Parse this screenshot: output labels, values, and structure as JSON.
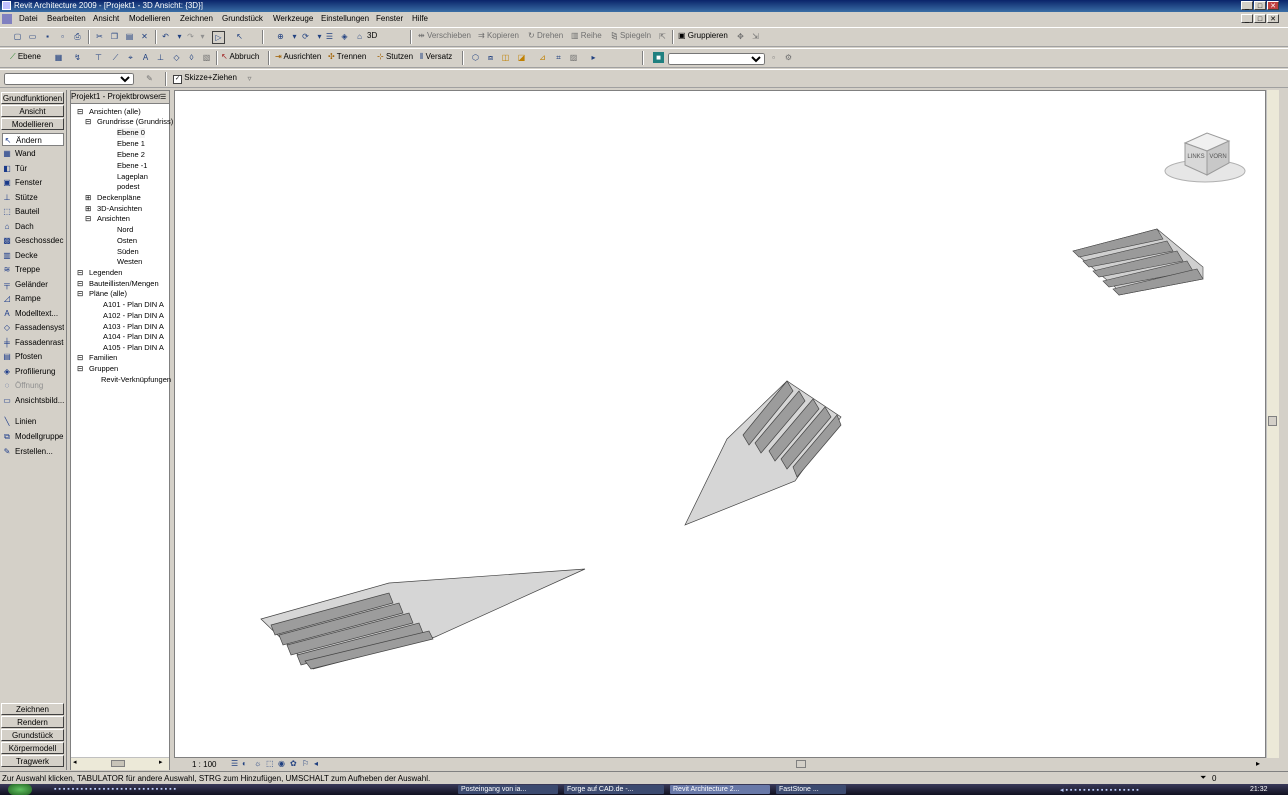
{
  "window": {
    "title": "Revit Architecture 2009 - [Projekt1 - 3D Ansicht: {3D}]"
  },
  "menu": [
    "Datei",
    "Bearbeiten",
    "Ansicht",
    "Modellieren",
    "Zeichnen",
    "Grundstück",
    "Werkzeuge",
    "Einstellungen",
    "Fenster",
    "Hilfe"
  ],
  "toolbar1": {
    "view3d_label": "3D",
    "verschieben": "Verschieben",
    "kopieren": "Kopieren",
    "drehen": "Drehen",
    "reihe": "Reihe",
    "spiegeln": "Spiegeln",
    "gruppieren": "Gruppieren"
  },
  "toolbar2": {
    "ebene": "Ebene",
    "abbruch": "Abbruch",
    "ausrichten": "Ausrichten",
    "trennen": "Trennen",
    "stutzen": "Stutzen",
    "versatz": "Versatz"
  },
  "toolbar3": {
    "skizze_checkbox": "Skizze+Ziehen"
  },
  "design_bar": {
    "headers": [
      "Grundfunktionen",
      "Ansicht",
      "Modellieren"
    ],
    "items": [
      {
        "label": "Ändern",
        "icon": "↖",
        "selected": true
      },
      {
        "label": "Wand",
        "icon": "▦"
      },
      {
        "label": "Tür",
        "icon": "◧"
      },
      {
        "label": "Fenster",
        "icon": "▣"
      },
      {
        "label": "Stütze",
        "icon": "⊥"
      },
      {
        "label": "Bauteil",
        "icon": "⬚"
      },
      {
        "label": "Dach",
        "icon": "⌂"
      },
      {
        "label": "Geschossdecke",
        "icon": "▩"
      },
      {
        "label": "Decke",
        "icon": "▥"
      },
      {
        "label": "Treppe",
        "icon": "≋"
      },
      {
        "label": "Geländer",
        "icon": "╤"
      },
      {
        "label": "Rampe",
        "icon": "◿"
      },
      {
        "label": "Modelltext...",
        "icon": "A"
      },
      {
        "label": "Fassadensyste",
        "icon": "◇"
      },
      {
        "label": "Fassadenraste",
        "icon": "╪"
      },
      {
        "label": "Pfosten",
        "icon": "▤"
      },
      {
        "label": "Profilierung",
        "icon": "◈"
      },
      {
        "label": "Öffnung",
        "icon": "◌",
        "disabled": true
      },
      {
        "label": "Ansichtsbild...",
        "icon": "▭"
      },
      {
        "label": "Linien",
        "icon": "╲"
      },
      {
        "label": "Modellgruppe",
        "icon": "⧉"
      },
      {
        "label": "Erstellen...",
        "icon": "✎"
      }
    ],
    "bottom_tabs": [
      "Zeichnen",
      "Rendern",
      "Grundstück",
      "Körpermodell",
      "Tragwerk"
    ]
  },
  "project_browser": {
    "title": "Projekt1 - Projektbrowser",
    "tree": [
      "Ansichten (alle)",
      "Grundrisse (Grundriss)",
      "Ebene 0",
      "Ebene 1",
      "Ebene 2",
      "Ebene -1",
      "Lageplan",
      "podest",
      "Deckenpläne",
      "3D-Ansichten",
      "Ansichten",
      "Nord",
      "Osten",
      "Süden",
      "Westen",
      "Legenden",
      "Bauteillisten/Mengen",
      "Pläne (alle)",
      "A101 - Plan DIN A",
      "A102 - Plan DIN A",
      "A103 - Plan DIN A",
      "A104 - Plan DIN A",
      "A105 - Plan DIN A",
      "Familien",
      "Gruppen",
      "Revit-Verknüpfungen"
    ]
  },
  "viewcube": {
    "face_left": "LINKS",
    "face_right": "VORN"
  },
  "view_controls": {
    "scale": "1 : 100"
  },
  "status": {
    "message": "Zur Auswahl klicken, TABULATOR für andere Auswahl, STRG zum Hinzufügen, UMSCHALT zum Aufheben der Auswahl.",
    "filter_count": "0"
  },
  "taskbar": {
    "tasks": [
      {
        "label": "Posteingang von ia..."
      },
      {
        "label": "Forge auf CAD.de -..."
      },
      {
        "label": "Revit Architecture 2...",
        "active": true
      },
      {
        "label": "FastStone ..."
      }
    ],
    "clock": "21:32"
  },
  "colors": {
    "title_blue": "#0a246a",
    "face_gray": "#d4d0c8",
    "model_fill": "#c0c0c0"
  }
}
